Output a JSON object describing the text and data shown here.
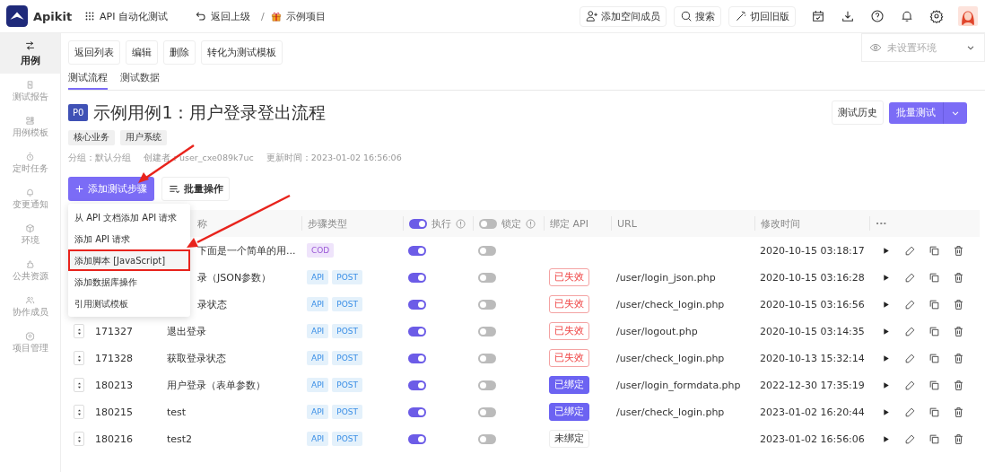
{
  "app": {
    "name": "Apikit"
  },
  "topbar": {
    "module": "API 自动化测试",
    "back": "返回上级",
    "separator": "/",
    "project": "示例项目",
    "actions": [
      "添加空间成员",
      "搜索",
      "切回旧版"
    ]
  },
  "sidebar": {
    "items": [
      {
        "label": "用例",
        "selected": true
      },
      {
        "label": "测试报告",
        "selected": false
      },
      {
        "label": "用例模板",
        "selected": false
      },
      {
        "label": "定时任务",
        "selected": false
      },
      {
        "label": "变更通知",
        "selected": false
      },
      {
        "label": "环境",
        "selected": false
      },
      {
        "label": "公共资源",
        "selected": false
      },
      {
        "label": "协作成员",
        "selected": false
      },
      {
        "label": "项目管理",
        "selected": false
      }
    ]
  },
  "toolbar": [
    "返回列表",
    "编辑",
    "删除",
    "转化为测试模板"
  ],
  "environment": {
    "placeholder": "未设置环境"
  },
  "tabs": [
    {
      "label": "测试流程",
      "selected": true
    },
    {
      "label": "测试数据",
      "selected": false
    }
  ],
  "case": {
    "priority": "P0",
    "title": "示例用例1：用户登录登出流程",
    "tags": [
      "核心业务",
      "用户系统"
    ],
    "meta": [
      "分组：默认分组",
      "创建者：user_cxe089k7uc",
      "更新时间：2023-01-02 16:56:06"
    ],
    "history": "测试历史",
    "batch_test": "批量测试"
  },
  "add_step": "添加测试步骤",
  "batch_ops": "批量操作",
  "menu": {
    "items": [
      {
        "label": "从 API 文档添加 API 请求",
        "highlighted": false
      },
      {
        "label": "添加 API 请求",
        "highlighted": false
      },
      {
        "label": "添加脚本 [JavaScript]",
        "highlighted": true
      },
      {
        "label": "添加数据库操作",
        "highlighted": false
      },
      {
        "label": "引用测试模板",
        "highlighted": false
      }
    ]
  },
  "table": {
    "columns": [
      "称",
      "步骤类型",
      "执行",
      "锁定",
      "绑定 API",
      "URL",
      "修改时间",
      "···"
    ],
    "exec_all": true,
    "lock_all": false,
    "rows": [
      {
        "name": "下面是一个简单的用...",
        "tags": [
          "COD"
        ],
        "kind": "code",
        "exec": true,
        "lock": false,
        "time": "2020-10-15 03:18:17"
      },
      {
        "name": "录（JSON参数）",
        "tags": [
          "API",
          "POST"
        ],
        "kind": "api",
        "exec": true,
        "lock": false,
        "binding": {
          "kind": "invalid",
          "label": "已失效"
        },
        "url": "/user/login_json.php",
        "time": "2020-10-15 03:16:28"
      },
      {
        "name": "录状态",
        "tags": [
          "API",
          "POST"
        ],
        "kind": "api",
        "exec": true,
        "lock": false,
        "binding": {
          "kind": "invalid",
          "label": "已失效"
        },
        "url": "/user/check_login.php",
        "time": "2020-10-15 03:16:56"
      },
      {
        "id": "171327",
        "name": "退出登录",
        "tags": [
          "API",
          "POST"
        ],
        "kind": "api",
        "exec": true,
        "lock": false,
        "binding": {
          "kind": "invalid",
          "label": "已失效"
        },
        "url": "/user/logout.php",
        "time": "2020-10-15 03:14:35"
      },
      {
        "id": "171328",
        "name": "获取登录状态",
        "tags": [
          "API",
          "POST"
        ],
        "kind": "api",
        "exec": true,
        "lock": false,
        "binding": {
          "kind": "invalid",
          "label": "已失效"
        },
        "url": "/user/check_login.php",
        "time": "2020-10-13 15:32:14"
      },
      {
        "id": "180213",
        "name": "用户登录（表单参数）",
        "tags": [
          "API",
          "POST"
        ],
        "kind": "api",
        "exec": true,
        "lock": false,
        "binding": {
          "kind": "bound",
          "label": "已绑定"
        },
        "url": "/user/login_formdata.php",
        "time": "2022-12-30 17:35:19"
      },
      {
        "id": "180215",
        "name": "test",
        "tags": [
          "API",
          "POST"
        ],
        "kind": "api",
        "exec": true,
        "lock": false,
        "binding": {
          "kind": "bound",
          "label": "已绑定"
        },
        "url": "/user/check_login.php",
        "time": "2023-01-02 16:20:44"
      },
      {
        "id": "180216",
        "name": "test2",
        "tags": [
          "API",
          "POST"
        ],
        "kind": "api",
        "exec": true,
        "lock": false,
        "binding": {
          "kind": "unbound",
          "label": "未绑定"
        },
        "time": "2023-01-02 16:56:06"
      }
    ]
  }
}
